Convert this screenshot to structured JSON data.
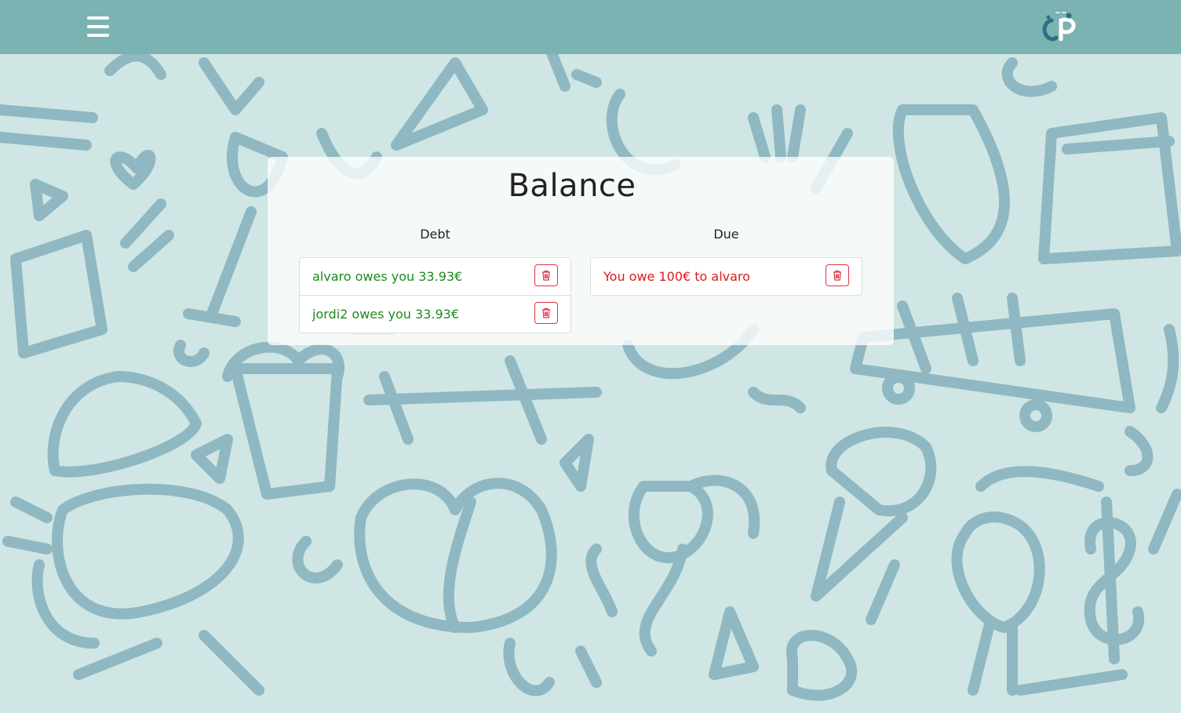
{
  "page": {
    "title": "Balance"
  },
  "navbar": {
    "menu_icon": "hamburger-icon",
    "logo": "app-logo"
  },
  "debt": {
    "heading": "Debt",
    "items": [
      {
        "text": "alvaro owes you 33.93€"
      },
      {
        "text": "jordi2 owes you 33.93€"
      }
    ]
  },
  "due": {
    "heading": "Due",
    "items": [
      {
        "text": "You owe 100€ to alvaro"
      }
    ]
  },
  "icons": {
    "delete": "trash-icon"
  },
  "colors": {
    "navbar": "#7ab3b2",
    "background": "#cfe6e4",
    "doodle": "#8fb8c2",
    "positive": "#1e8a1e",
    "negative": "#dd1a1a",
    "danger": "#dc3545"
  }
}
